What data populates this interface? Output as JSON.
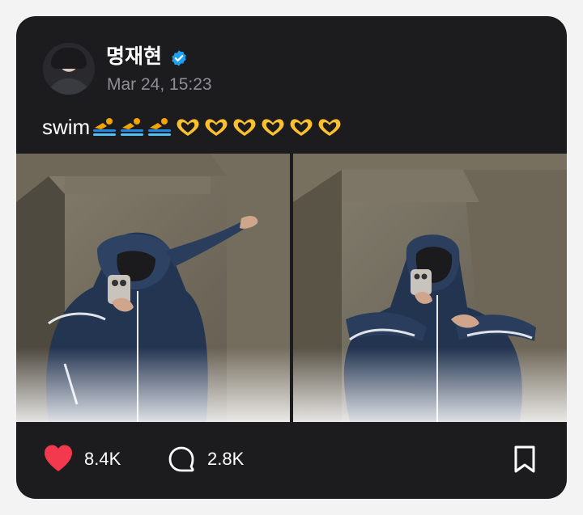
{
  "post": {
    "author": {
      "name": "명재현",
      "verified": true
    },
    "timestamp": "Mar 24, 15:23",
    "caption": {
      "text": "swim",
      "emojis": [
        "swimmer",
        "swimmer",
        "swimmer",
        "heart-hands",
        "heart-hands",
        "heart-hands",
        "heart-hands",
        "heart-hands",
        "heart-hands"
      ]
    },
    "photos": [
      {
        "name": "mirror-selfie-dab"
      },
      {
        "name": "mirror-selfie-pose"
      }
    ],
    "actions": {
      "likes": "8.4K",
      "comments": "2.8K",
      "liked": true
    }
  },
  "colors": {
    "card": "#1c1c1e",
    "like": "#f2394d",
    "verified": "#1ea1f2",
    "muted": "#8e8e93"
  }
}
